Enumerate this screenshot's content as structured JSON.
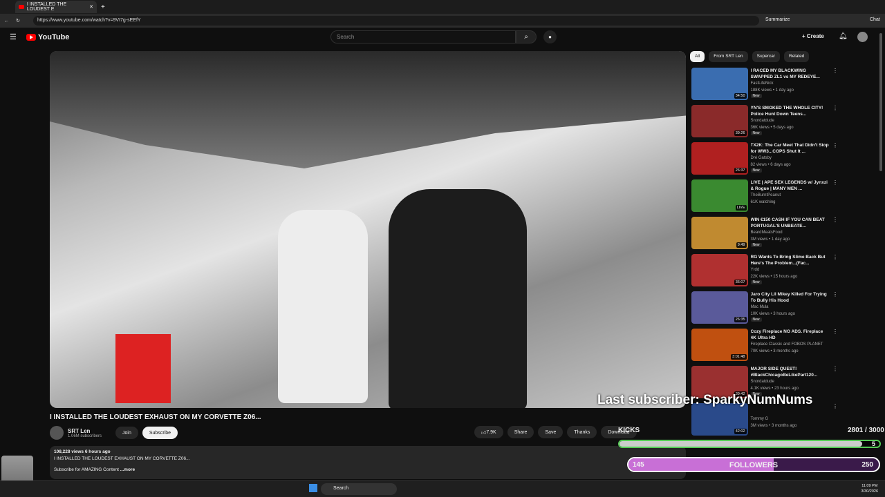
{
  "browser": {
    "tab_title": "I INSTALLED THE LOUDEST E",
    "url": "https://www.youtube.com/watch?v=9Vt7g-sEEfY",
    "summarize": "Summarize",
    "chat": "Chat"
  },
  "header": {
    "logo": "YouTube",
    "search_placeholder": "Search",
    "create": "Create"
  },
  "video": {
    "title": "I INSTALLED THE LOUDEST EXHAUST ON MY CORVETTE Z06...",
    "channel": "SRT Len",
    "subscribers": "1.06M subscribers",
    "join": "Join",
    "subscribe": "Subscribe",
    "likes": "7.9K",
    "share": "Share",
    "save": "Save",
    "thanks": "Thanks",
    "download": "Download"
  },
  "description": {
    "stats": "108,228 views  6 hours ago",
    "line1": "I INSTALLED THE LOUDEST EXHAUST ON MY CORVETTE Z06...",
    "line2": "Subscribe for AMAZING Content",
    "more": "...more"
  },
  "chips": [
    "All",
    "From SRT Len",
    "Supercar",
    "Related"
  ],
  "recommendations": [
    {
      "title": "I RACED MY BLACKWING SWAPPED ZL1 vs MY REDEYE...",
      "channel": "FastLifeNick",
      "meta": "188K views • 1 day ago",
      "badge": "New",
      "duration": "34:50",
      "color": "#3a6db0"
    },
    {
      "title": "YN'S SMOKED THE WHOLE CITY! Police Hunt Down Teens...",
      "channel": "Snordatdude",
      "meta": "36K views • 5 days ago",
      "badge": "New",
      "duration": "39:26",
      "color": "#8a2a2a"
    },
    {
      "title": "TX2K: The Car Meet That Didn't Stop for WW3...COPS Shut It ...",
      "channel": "Dré Gatsby",
      "meta": "82 views • 6 days ago",
      "badge": "New",
      "duration": "26:37",
      "color": "#b02020"
    },
    {
      "title": "LIVE | APE SEX LEGENDS w/ Jynxzi & Rogue | MANY MEN ...",
      "channel": "TheBurntPeanut",
      "meta": "61K watching",
      "badge": "",
      "duration": "LIVE",
      "color": "#3a8a30"
    },
    {
      "title": "WIN €150 CASH IF YOU CAN BEAT PORTUGAL'S UNBEATE...",
      "channel": "BeardMeatsFood",
      "meta": "3M views • 1 day ago",
      "badge": "New",
      "duration": "9:49",
      "color": "#c08a30"
    },
    {
      "title": "RG Wants To Bring Slime Back But Here's The Problem...(Fac...",
      "channel": "Yrdd",
      "meta": "22K views • 15 hours ago",
      "badge": "New",
      "duration": "36:07",
      "color": "#b03030"
    },
    {
      "title": "Jaro City Lil Mikey Killed For Trying To Bully His Hood",
      "channel": "Mac Mula",
      "meta": "10K views • 3 hours ago",
      "badge": "New",
      "duration": "26:35",
      "color": "#5a5a9a"
    },
    {
      "title": "Cozy Fireplace NO ADS. Fireplace 4K Ultra HD",
      "channel": "Fireplace Classic and FOBOS PLANET",
      "meta": "70K views • 3 months ago",
      "badge": "",
      "duration": "3:01:48",
      "color": "#c05010"
    },
    {
      "title": "MAJOR SIDE QUEST! #BlackChicagoBeLikePart120...",
      "channel": "Snordatdude",
      "meta": "4.1K views • 23 hours ago",
      "badge": "New",
      "duration": "39:42",
      "color": "#9a3030"
    },
    {
      "title": "",
      "channel": "Tommy G",
      "meta": "3M views • 3 months ago",
      "badge": "",
      "duration": "42:02",
      "color": "#2a4a8a"
    }
  ],
  "overlay": {
    "last_subscriber": "Last subscriber: SparkyNumNums",
    "kicks": "KICKS",
    "kicks_count": "2801 / 3000",
    "bar1_value": "5",
    "followers_current": "145",
    "followers_label": "FOLLOWERS",
    "followers_goal": "250",
    "kicks_progress": 0.934,
    "followers_progress": 0.58
  },
  "taskbar": {
    "search": "Search",
    "time": "11:09 PM",
    "date": "3/30/2026"
  }
}
